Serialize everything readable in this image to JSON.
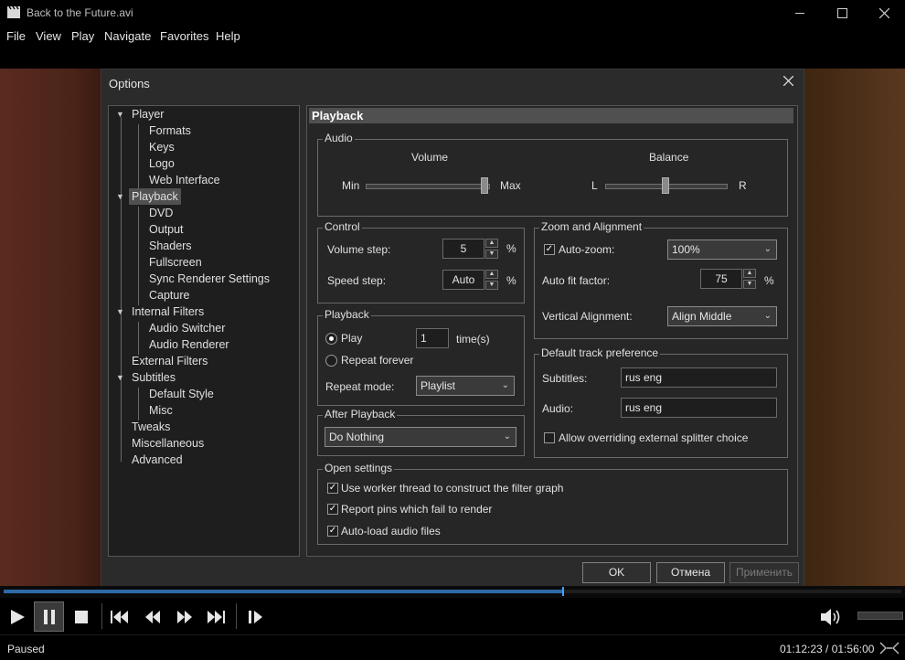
{
  "window": {
    "title": "Back to the Future.avi"
  },
  "menu": [
    "File",
    "View",
    "Play",
    "Navigate",
    "Favorites",
    "Help"
  ],
  "dialog": {
    "title": "Options",
    "tree": [
      {
        "label": "Player"
      },
      {
        "label": "Formats"
      },
      {
        "label": "Keys"
      },
      {
        "label": "Logo"
      },
      {
        "label": "Web Interface"
      },
      {
        "label": "Playback"
      },
      {
        "label": "DVD"
      },
      {
        "label": "Output"
      },
      {
        "label": "Shaders"
      },
      {
        "label": "Fullscreen"
      },
      {
        "label": "Sync Renderer Settings"
      },
      {
        "label": "Capture"
      },
      {
        "label": "Internal Filters"
      },
      {
        "label": "Audio Switcher"
      },
      {
        "label": "Audio Renderer"
      },
      {
        "label": "External Filters"
      },
      {
        "label": "Subtitles"
      },
      {
        "label": "Default Style"
      },
      {
        "label": "Misc"
      },
      {
        "label": "Tweaks"
      },
      {
        "label": "Miscellaneous"
      },
      {
        "label": "Advanced"
      }
    ],
    "selected_tree_item": "Playback",
    "page_title": "Playback",
    "audio": {
      "group": "Audio",
      "volume_label": "Volume",
      "min": "Min",
      "max": "Max",
      "balance_label": "Balance",
      "left": "L",
      "right": "R",
      "volume_level": 1.0,
      "balance_level": 0.5
    },
    "control": {
      "group": "Control",
      "volume_step_label": "Volume step:",
      "volume_step": "5",
      "volume_unit": "%",
      "speed_step_label": "Speed step:",
      "speed_step": "Auto",
      "speed_unit": "%"
    },
    "zoom": {
      "group": "Zoom and Alignment",
      "autozoom_label": "Auto-zoom:",
      "autozoom_checked": true,
      "autozoom_value": "100%",
      "autofit_label": "Auto fit factor:",
      "autofit_value": "75",
      "autofit_unit": "%",
      "valign_label": "Vertical Alignment:",
      "valign_value": "Align Middle"
    },
    "playback": {
      "group": "Playback",
      "play_label": "Play",
      "play_count": "1",
      "times_label": "time(s)",
      "repeat_forever_label": "Repeat forever",
      "repeat_mode_label": "Repeat mode:",
      "repeat_mode": "Playlist"
    },
    "after_playback": {
      "group": "After Playback",
      "value": "Do Nothing"
    },
    "track_pref": {
      "group": "Default track preference",
      "subtitles_label": "Subtitles:",
      "subtitles_value": "rus eng",
      "audio_label": "Audio:",
      "audio_value": "rus eng",
      "override_label": "Allow overriding external splitter choice"
    },
    "open_settings": {
      "group": "Open settings",
      "items": [
        "Use worker thread to construct the filter graph",
        "Report pins which fail to render",
        "Auto-load audio files"
      ]
    },
    "buttons": {
      "ok": "OK",
      "cancel": "Отмена",
      "apply": "Применить"
    }
  },
  "player": {
    "seek_progress": 0.623,
    "status": "Paused",
    "time": "01:12:23 / 01:56:00"
  }
}
